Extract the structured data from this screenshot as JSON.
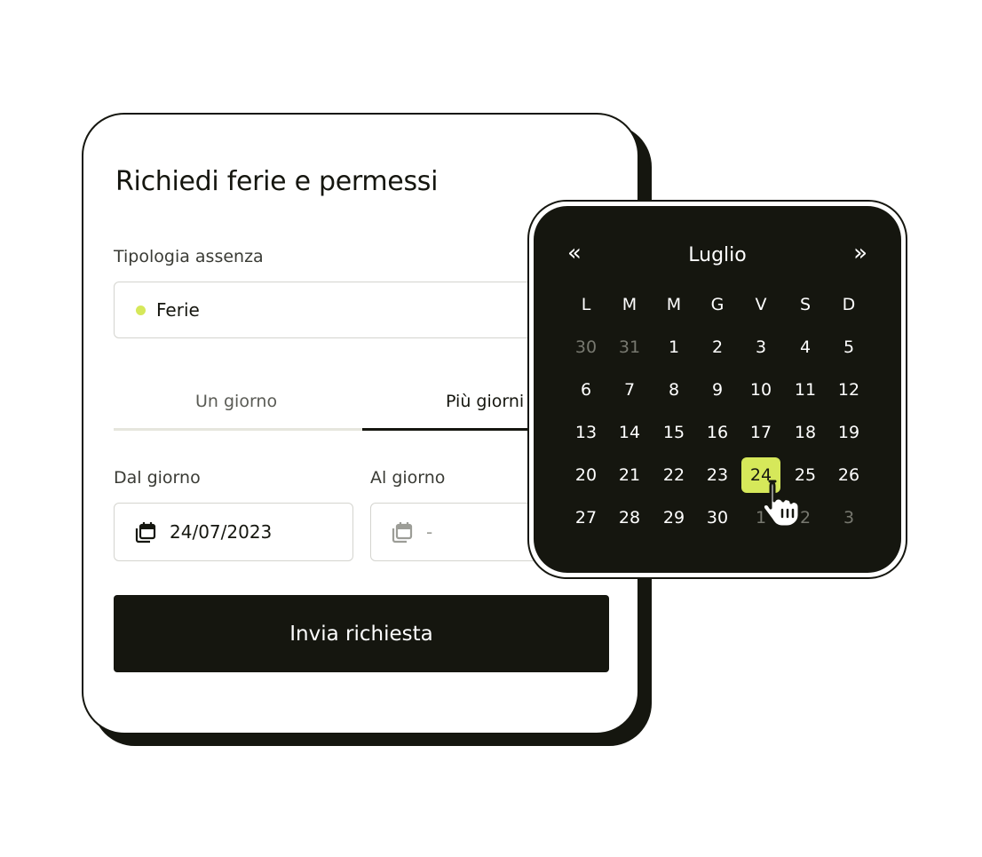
{
  "form": {
    "title": "Richiedi ferie e permessi",
    "absence_type_label": "Tipologia assenza",
    "absence_type_value": "Ferie",
    "absence_type_dot_color": "#d6e85a",
    "tabs": [
      {
        "label": "Un giorno",
        "active": false
      },
      {
        "label": "Più giorni",
        "active": true
      }
    ],
    "from_label": "Dal giorno",
    "from_value": "24/07/2023",
    "to_label": "Al giorno",
    "to_value": "-",
    "submit_label": "Invia richiesta"
  },
  "calendar": {
    "prev": "«",
    "next": "»",
    "month": "Luglio",
    "weekdays": [
      "L",
      "M",
      "M",
      "G",
      "V",
      "S",
      "D"
    ],
    "weeks": [
      [
        {
          "d": "30",
          "muted": true
        },
        {
          "d": "31",
          "muted": true
        },
        {
          "d": "1"
        },
        {
          "d": "2"
        },
        {
          "d": "3"
        },
        {
          "d": "4"
        },
        {
          "d": "5"
        }
      ],
      [
        {
          "d": "6"
        },
        {
          "d": "7"
        },
        {
          "d": "8"
        },
        {
          "d": "9"
        },
        {
          "d": "10"
        },
        {
          "d": "11"
        },
        {
          "d": "12"
        }
      ],
      [
        {
          "d": "13"
        },
        {
          "d": "14"
        },
        {
          "d": "15"
        },
        {
          "d": "16"
        },
        {
          "d": "17"
        },
        {
          "d": "18"
        },
        {
          "d": "19"
        }
      ],
      [
        {
          "d": "20"
        },
        {
          "d": "21"
        },
        {
          "d": "22"
        },
        {
          "d": "23"
        },
        {
          "d": "24",
          "selected": true
        },
        {
          "d": "25"
        },
        {
          "d": "26"
        }
      ],
      [
        {
          "d": "27"
        },
        {
          "d": "28"
        },
        {
          "d": "29"
        },
        {
          "d": "30"
        },
        {
          "d": "1",
          "muted": true
        },
        {
          "d": "2",
          "muted": true
        },
        {
          "d": "3",
          "muted": true
        }
      ]
    ],
    "selected_color": "#d6e85a",
    "background_color": "#15160f"
  }
}
